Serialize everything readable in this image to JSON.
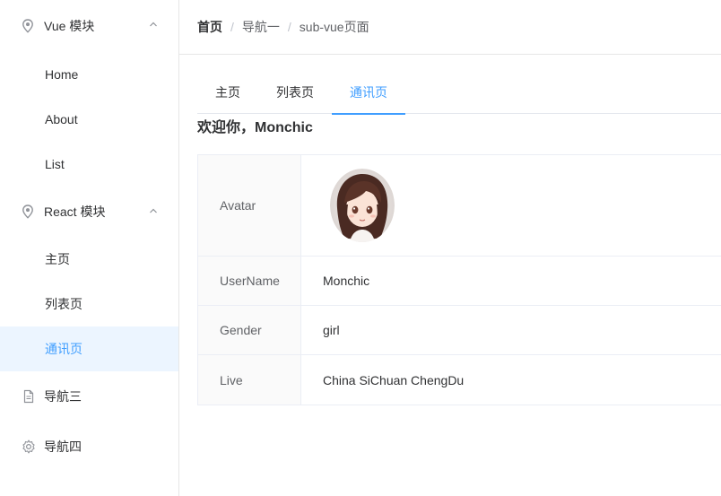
{
  "sidebar": {
    "groups": [
      {
        "title": "Vue 模块",
        "items": [
          "Home",
          "About",
          "List"
        ]
      },
      {
        "title": "React 模块",
        "items": [
          "主页",
          "列表页",
          "通讯页"
        ]
      }
    ],
    "active_item": "通讯页",
    "nav3": "导航三",
    "nav4": "导航四"
  },
  "breadcrumb": [
    "首页",
    "导航一",
    "sub-vue页面"
  ],
  "breadcrumb_separator": "/",
  "tabs": [
    "主页",
    "列表页",
    "通讯页"
  ],
  "active_tab": "通讯页",
  "welcome": "欢迎你，Monchic",
  "profile": {
    "avatar_label": "Avatar",
    "username_label": "UserName",
    "username": "Monchic",
    "gender_label": "Gender",
    "gender": "girl",
    "live_label": "Live",
    "live": "China SiChuan ChengDu"
  },
  "colors": {
    "accent": "#409eff",
    "active_bg": "#ecf5ff",
    "border": "#e6e6e6",
    "label_bg": "#fafafa"
  },
  "icons": {
    "group": "location-pin-icon",
    "group_arrow": "chevron-up-icon",
    "nav3": "document-icon",
    "nav4": "gear-icon"
  }
}
